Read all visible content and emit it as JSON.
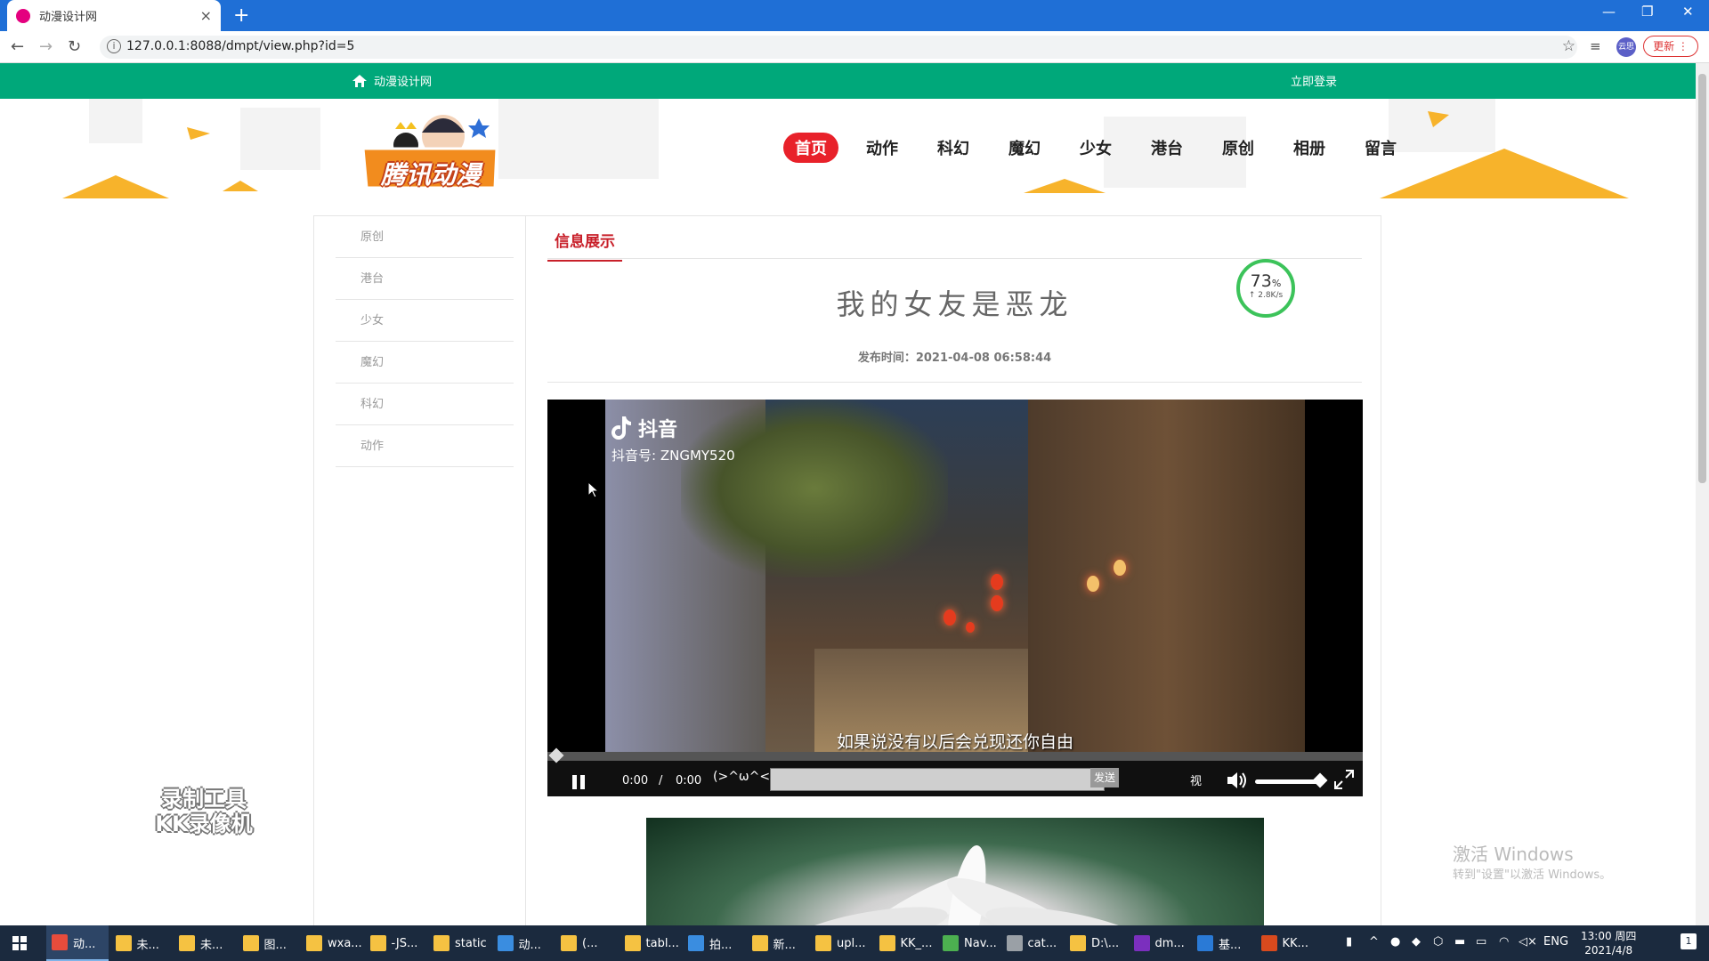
{
  "browser": {
    "tab_title": "动漫设计网",
    "tab_close": "×",
    "new_tab": "+",
    "url": "127.0.0.1:8088/dmpt/view.php?id=5",
    "avatar": "云思",
    "update_label": "更新 ⋮",
    "window_controls": [
      "—",
      "❐",
      "✕"
    ]
  },
  "topbar": {
    "home_label": "动漫设计网",
    "login_label": "立即登录"
  },
  "logo": {
    "text": "腾讯动漫"
  },
  "nav": {
    "items": [
      "首页",
      "动作",
      "科幻",
      "魔幻",
      "少女",
      "港台",
      "原创",
      "相册",
      "留言"
    ],
    "active_index": 0,
    "active_color": "#e8212a"
  },
  "sidebar": {
    "items": [
      "原创",
      "港台",
      "少女",
      "魔幻",
      "科幻",
      "动作"
    ]
  },
  "main": {
    "section_title": "信息展示",
    "article_title": "我的女友是恶龙",
    "publish_time": "发布时间：2021-04-08 06:58:44"
  },
  "speed_widget": {
    "percent": "73",
    "percent_sign": "%",
    "rate": "↑ 2.8K/s"
  },
  "video": {
    "app_name": "抖音",
    "account": "抖音号: ZNGMY520",
    "subtitle": "如果说没有以后会兑现还你自由",
    "current_time": "0:00",
    "separator": "/",
    "total_time": "0:00",
    "emoticon": "(>^ω^<)",
    "send_label": "发送",
    "style_label": "视",
    "progress": 0.0,
    "volume": 0.9
  },
  "watermark": {
    "line1": "录制工具",
    "line2": "KK录像机"
  },
  "activation": {
    "title": "激活 Windows",
    "subtitle": "转到\"设置\"以激活 Windows。"
  },
  "taskbar": {
    "items": [
      "动...",
      "未...",
      "未...",
      "图...",
      "wxa...",
      "-JS...",
      "static",
      "动...",
      "(...",
      "tabl...",
      "拍...",
      "新...",
      "upl...",
      "KK_...",
      "Nav...",
      "cat...",
      "D:\\...",
      "dm...",
      "基...",
      "KK..."
    ],
    "lang": "ENG",
    "time": "13:00 周四",
    "date": "2021/4/8",
    "notify_count": "1"
  },
  "colors": {
    "brand_green": "#00a87a",
    "accent_red": "#c8202a",
    "chrome_blue": "#1f6fd6"
  }
}
